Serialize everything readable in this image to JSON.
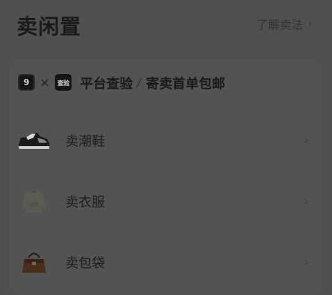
{
  "header": {
    "title": "卖闲置",
    "learn_link": "了解卖法",
    "chevron": "›"
  },
  "promo": {
    "logo_90": "9",
    "times": "×",
    "logo_inspect": "查验",
    "platform_text": "平台查验",
    "slash": "/",
    "consign_text": "寄卖首单包邮"
  },
  "categories": [
    {
      "label": "卖潮鞋",
      "icon": "sneaker-icon"
    },
    {
      "label": "卖衣服",
      "icon": "hoodie-icon"
    },
    {
      "label": "卖包袋",
      "icon": "handbag-icon"
    }
  ],
  "colors": {
    "background": "#4f4f4f",
    "card": "#535353",
    "accent_slash": "#1b4a3c"
  }
}
